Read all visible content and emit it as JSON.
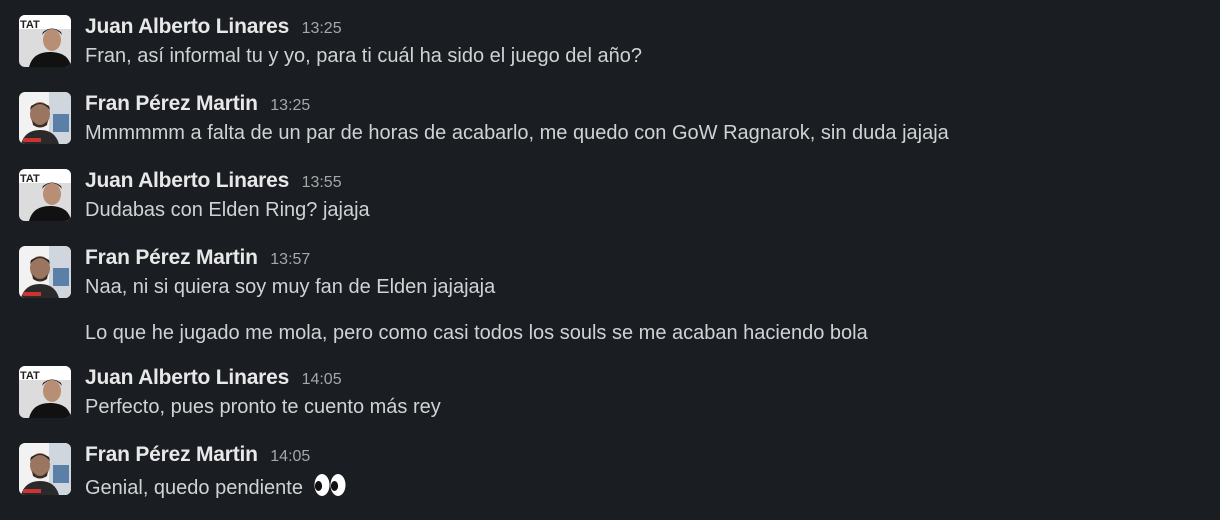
{
  "messages": [
    {
      "author": "Juan Alberto Linares",
      "time": "13:25",
      "avatar": "juan-avatar",
      "lines": [
        "Fran, así informal tu y yo, para ti cuál ha sido el juego del año?"
      ]
    },
    {
      "author": "Fran Pérez Martin",
      "time": "13:25",
      "avatar": "fran-avatar",
      "lines": [
        "Mmmmmm a falta de un par de horas de acabarlo, me quedo con GoW Ragnarok, sin duda jajaja"
      ]
    },
    {
      "author": "Juan Alberto Linares",
      "time": "13:55",
      "avatar": "juan-avatar",
      "lines": [
        "Dudabas con Elden Ring? jajaja"
      ]
    },
    {
      "author": "Fran Pérez Martin",
      "time": "13:57",
      "avatar": "fran-avatar",
      "lines": [
        "Naa, ni si quiera soy muy fan de Elden jajajaja",
        "Lo que he jugado me mola, pero como casi todos los souls se me acaban haciendo bola"
      ]
    },
    {
      "author": "Juan Alberto Linares",
      "time": "14:05",
      "avatar": "juan-avatar",
      "lines": [
        "Perfecto, pues pronto te cuento más rey"
      ]
    },
    {
      "author": "Fran Pérez Martin",
      "time": "14:05",
      "avatar": "fran-avatar",
      "lines": [
        "Genial, quedo pendiente"
      ],
      "emoji": "eyes-emoji-icon"
    }
  ],
  "avatar_texts": {
    "juan": "TAT"
  },
  "colors": {
    "background": "#1a1d21",
    "author": "#e8e8e8",
    "timestamp": "#a6a7a9",
    "body": "#d1d2d3"
  }
}
